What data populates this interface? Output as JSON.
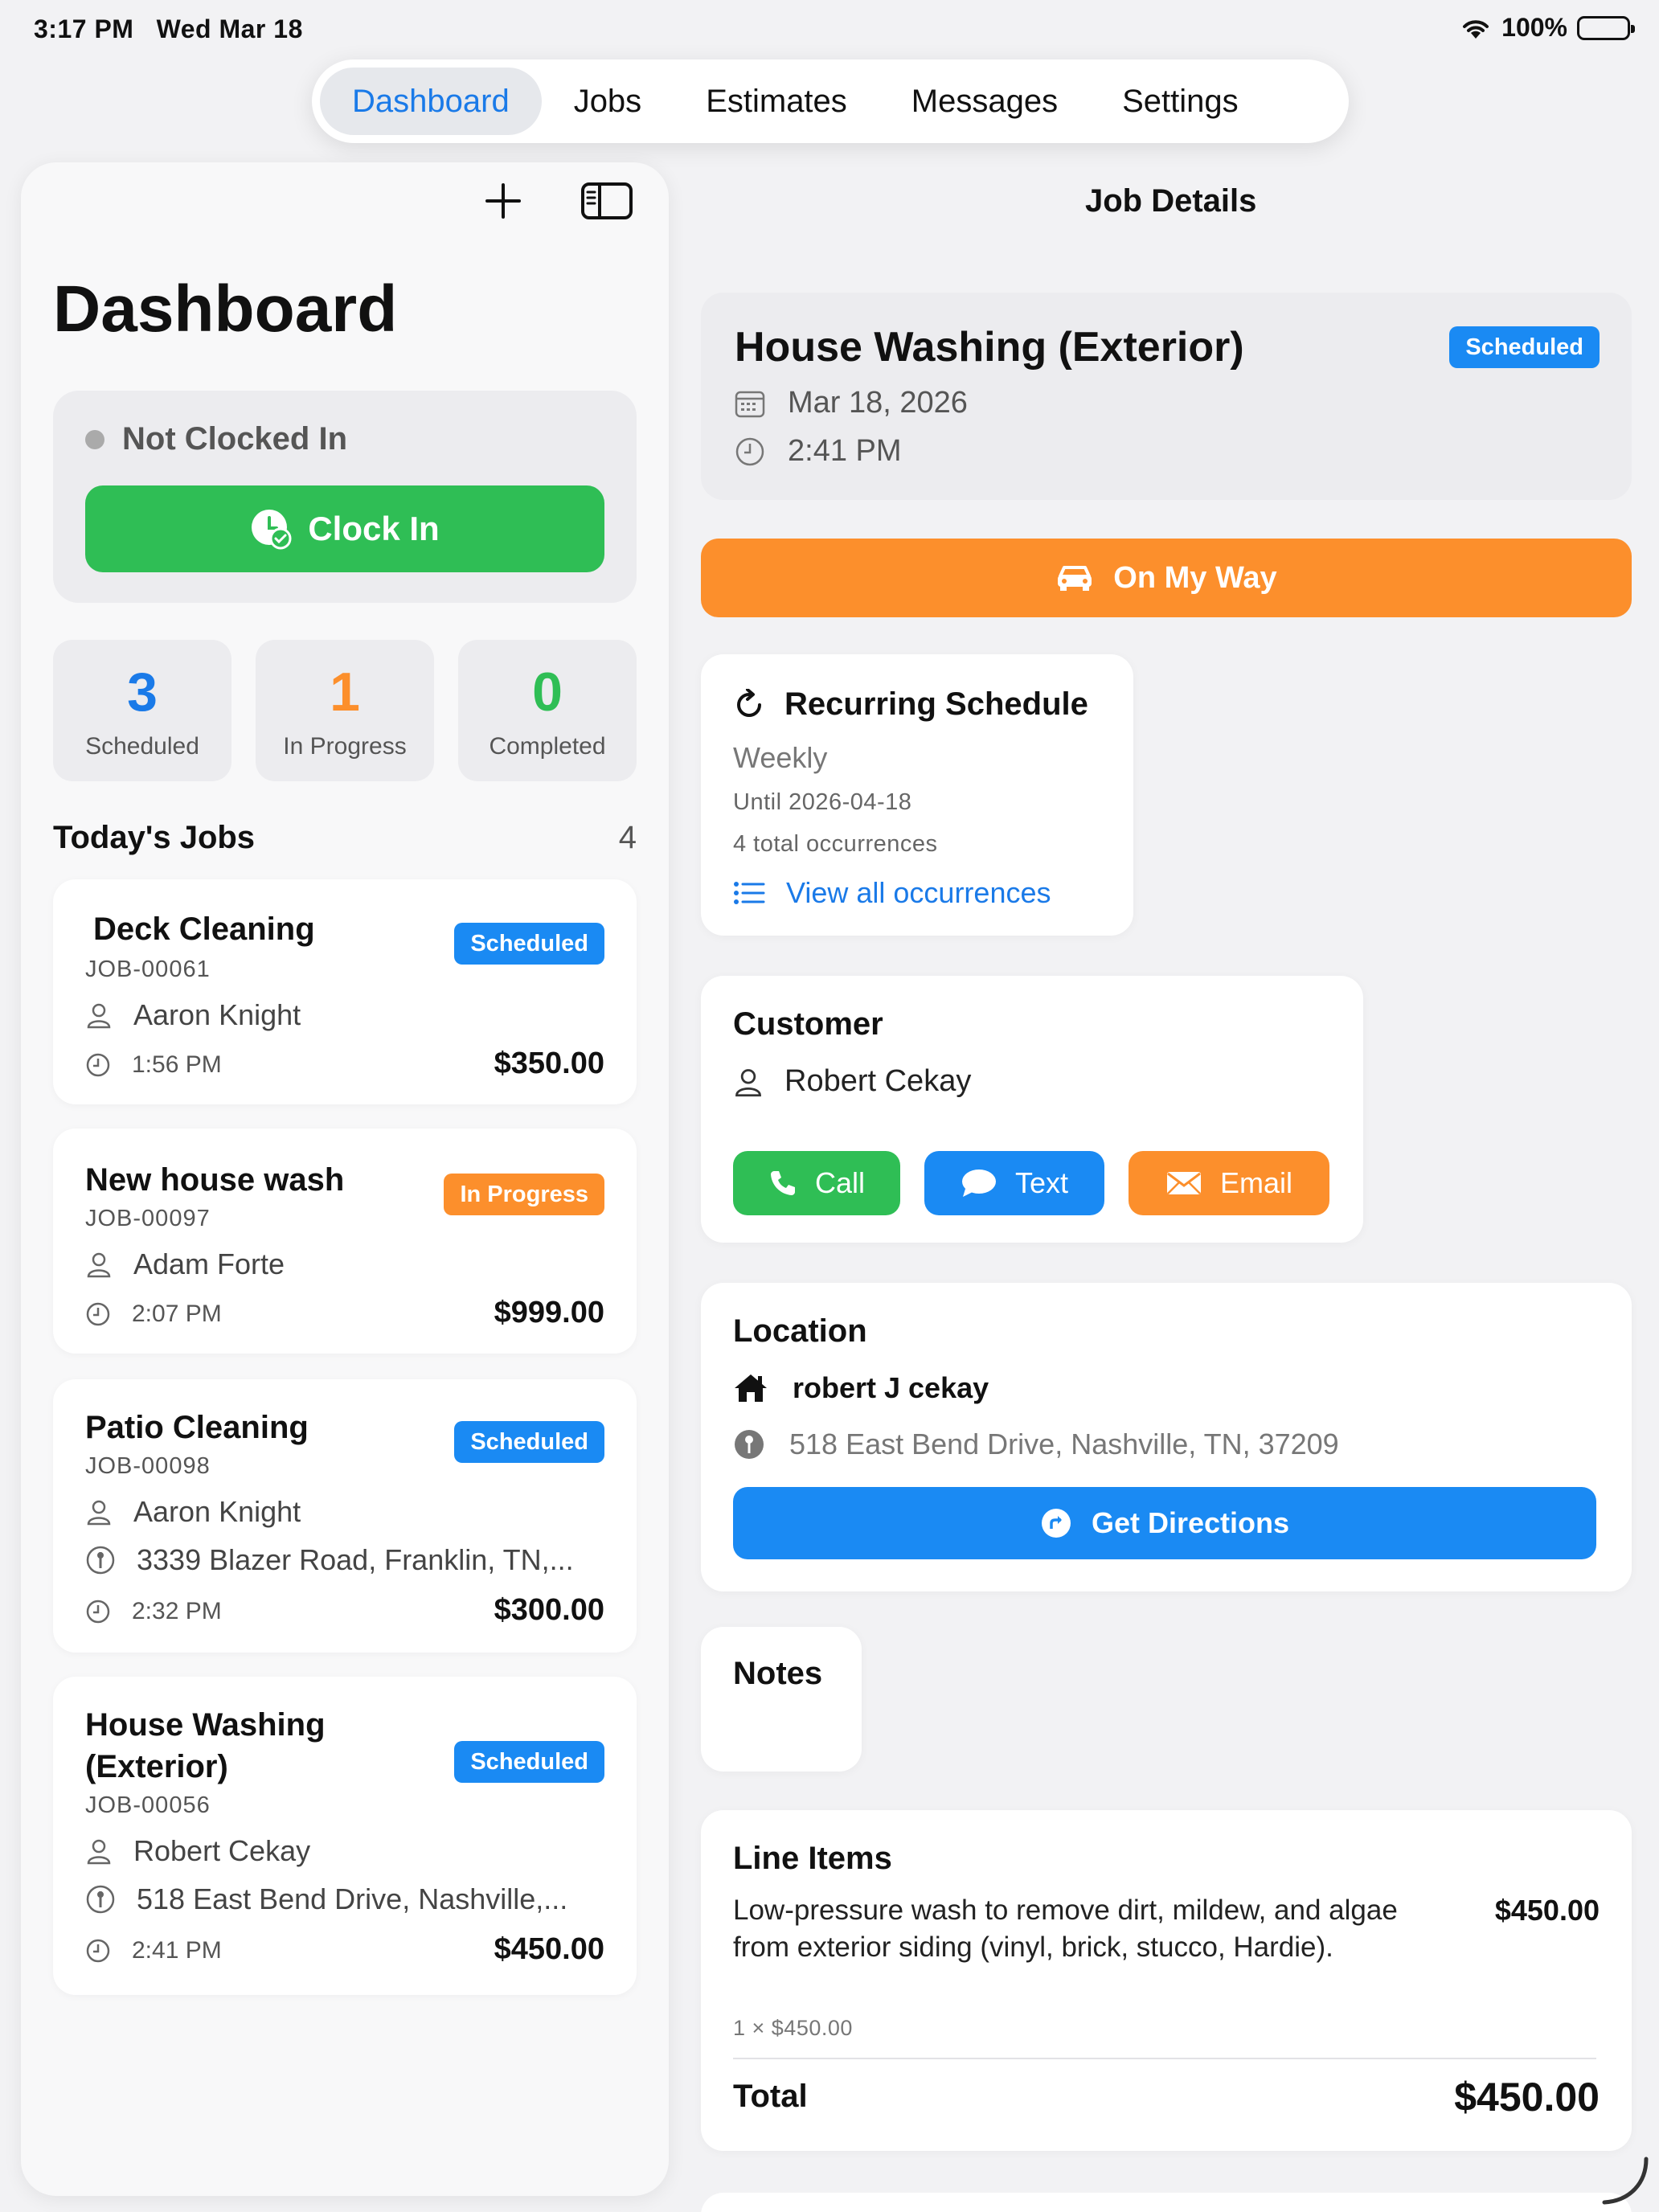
{
  "status_bar": {
    "time": "3:17 PM",
    "date": "Wed Mar 18",
    "battery": "100%"
  },
  "tabs": [
    {
      "label": "Dashboard",
      "active": true
    },
    {
      "label": "Jobs"
    },
    {
      "label": "Estimates"
    },
    {
      "label": "Messages"
    },
    {
      "label": "Settings"
    }
  ],
  "dashboard": {
    "title": "Dashboard",
    "clock": {
      "status": "Not Clocked In",
      "button": "Clock In"
    },
    "stats": [
      {
        "value": "3",
        "label": "Scheduled",
        "color": "#1a7ae8"
      },
      {
        "value": "1",
        "label": "In Progress",
        "color": "#fc8f2c"
      },
      {
        "value": "0",
        "label": "Completed",
        "color": "#2fbe55"
      }
    ],
    "jobs_header": "Today's Jobs",
    "jobs_count": "4",
    "jobs": [
      {
        "title": "Deck Cleaning",
        "id": "JOB-00061",
        "status": "Scheduled",
        "customer": "Aaron Knight",
        "address": "",
        "time": "1:56 PM",
        "price": "$350.00"
      },
      {
        "title": "New house wash",
        "id": "JOB-00097",
        "status": "In Progress",
        "customer": "Adam Forte",
        "address": "",
        "time": "2:07 PM",
        "price": "$999.00"
      },
      {
        "title": "Patio Cleaning",
        "id": "JOB-00098",
        "status": "Scheduled",
        "customer": "Aaron Knight",
        "address": "3339 Blazer Road, Franklin, TN,...",
        "time": "2:32 PM",
        "price": "$300.00"
      },
      {
        "title": "House Washing (Exterior)",
        "id": "JOB-00056",
        "status": "Scheduled",
        "customer": "Robert Cekay",
        "address": "518 East Bend Drive, Nashville,...",
        "time": "2:41 PM",
        "price": "$450.00"
      }
    ]
  },
  "job_details": {
    "nav_title": "Job Details",
    "title": "House Washing (Exterior)",
    "status": "Scheduled",
    "date": "Mar 18, 2026",
    "time": "2:41 PM",
    "on_my_way": "On My Way",
    "recurring": {
      "heading": "Recurring Schedule",
      "frequency": "Weekly",
      "until": "Until 2026-04-18",
      "occurrences": "4 total occurrences",
      "link": "View all occurrences"
    },
    "customer": {
      "heading": "Customer",
      "name": "Robert Cekay",
      "call": "Call",
      "text": "Text",
      "email": "Email"
    },
    "location": {
      "heading": "Location",
      "name": "robert J cekay",
      "address": "518 East Bend Drive, Nashville, TN, 37209",
      "directions": "Get Directions"
    },
    "notes": {
      "heading": "Notes"
    },
    "line_items": {
      "heading": "Line Items",
      "items": [
        {
          "description": "Low-pressure wash to remove dirt, mildew, and algae from exterior siding (vinyl, brick, stucco, Hardie).",
          "qty": "1 × $450.00",
          "price": "$450.00"
        }
      ],
      "total_label": "Total",
      "total": "$450.00"
    }
  },
  "colors": {
    "blue": "#1a8af3",
    "green": "#2fbe55",
    "orange": "#fc8f2c"
  }
}
